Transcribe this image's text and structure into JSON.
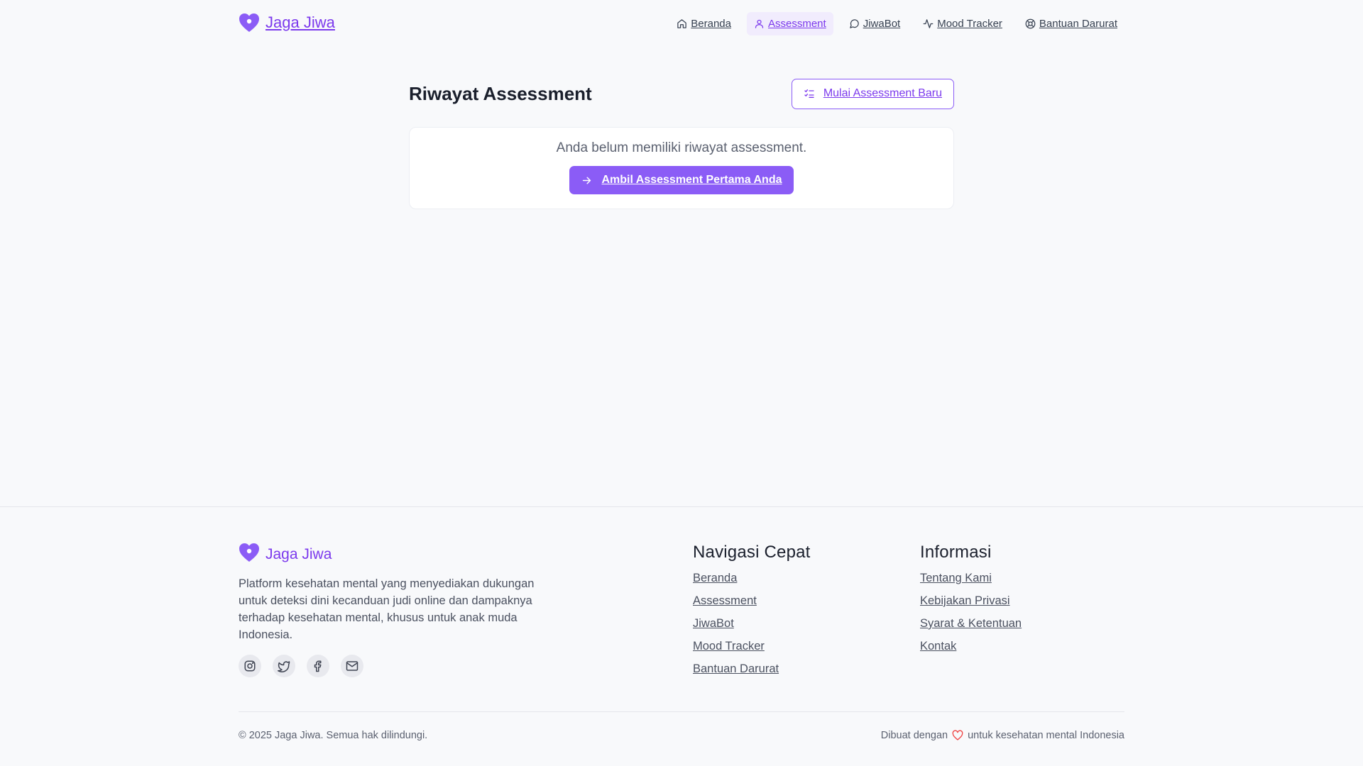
{
  "header": {
    "brand_name": "Jaga Jiwa",
    "nav": [
      {
        "label": "Beranda",
        "icon": "home-icon"
      },
      {
        "label": "Assessment",
        "icon": "user-icon",
        "active": true
      },
      {
        "label": "JiwaBot",
        "icon": "chat-bubble-icon"
      },
      {
        "label": "Mood Tracker",
        "icon": "activity-icon"
      },
      {
        "label": "Bantuan Darurat",
        "icon": "lifebuoy-icon"
      }
    ]
  },
  "main": {
    "title": "Riwayat Assessment",
    "new_button_label": "Mulai Assessment Baru",
    "empty_message": "Anda belum memiliki riwayat assessment.",
    "first_button_label": "Ambil Assessment Pertama Anda"
  },
  "footer": {
    "brand_name": "Jaga Jiwa",
    "description": "Platform kesehatan mental yang menyediakan dukungan untuk deteksi dini kecanduan judi online dan dampaknya terhadap kesehatan mental, khusus untuk anak muda Indonesia.",
    "socials": [
      "instagram-icon",
      "twitter-icon",
      "facebook-icon",
      "mail-icon"
    ],
    "quick_nav": {
      "title": "Navigasi Cepat",
      "links": [
        "Beranda",
        "Assessment",
        "JiwaBot",
        "Mood Tracker",
        "Bantuan Darurat"
      ]
    },
    "info": {
      "title": "Informasi",
      "links": [
        "Tentang Kami",
        "Kebijakan Privasi",
        "Syarat & Ketentuan",
        "Kontak"
      ]
    },
    "copyright": "© 2025 Jaga Jiwa. Semua hak dilindungi.",
    "made_with_prefix": "Dibuat dengan",
    "made_with_suffix": "untuk kesehatan mental Indonesia"
  },
  "colors": {
    "accent": "#8b5cf6",
    "accent_text": "#7c3aed",
    "heart_red": "#ef4444",
    "background": "#f8f9fb"
  }
}
